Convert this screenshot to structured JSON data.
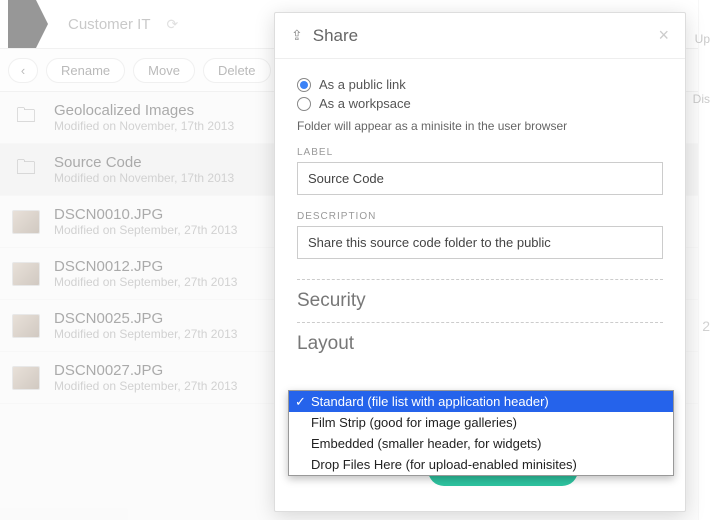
{
  "breadcrumb": {
    "label": "Customer IT"
  },
  "toolbar": {
    "back": "‹",
    "rename": "Rename",
    "move": "Move",
    "delete": "Delete"
  },
  "files": [
    {
      "name": "Geolocalized Images",
      "mod": "Modified on November, 17th 2013",
      "type": "folder"
    },
    {
      "name": "Source Code",
      "mod": "Modified on November, 17th 2013",
      "type": "folder"
    },
    {
      "name": "DSCN0010.JPG",
      "mod": "Modified on September, 27th 2013",
      "type": "img"
    },
    {
      "name": "DSCN0012.JPG",
      "mod": "Modified on September, 27th 2013",
      "type": "img"
    },
    {
      "name": "DSCN0025.JPG",
      "mod": "Modified on September, 27th 2013",
      "type": "img"
    },
    {
      "name": "DSCN0027.JPG",
      "mod": "Modified on September, 27th 2013",
      "type": "img"
    }
  ],
  "right": {
    "up": "Up",
    "dis": "Dis",
    "num": "2"
  },
  "dialog": {
    "title": "Share",
    "radio_public": "As a public link",
    "radio_workspace": "As a workpsace",
    "hint": "Folder will appear as a minisite in the user browser",
    "label_label": "LABEL",
    "label_value": "Source Code",
    "desc_label": "DESCRIPTION",
    "desc_value": "Share this source code folder to the public",
    "security_title": "Security",
    "layout_title": "Layout",
    "options": [
      "Standard (file list with application header)",
      "Film Strip (good for image galleries)",
      "Embedded (smaller header, for widgets)",
      "Drop Files Here (for upload-enabled minisites)"
    ]
  }
}
